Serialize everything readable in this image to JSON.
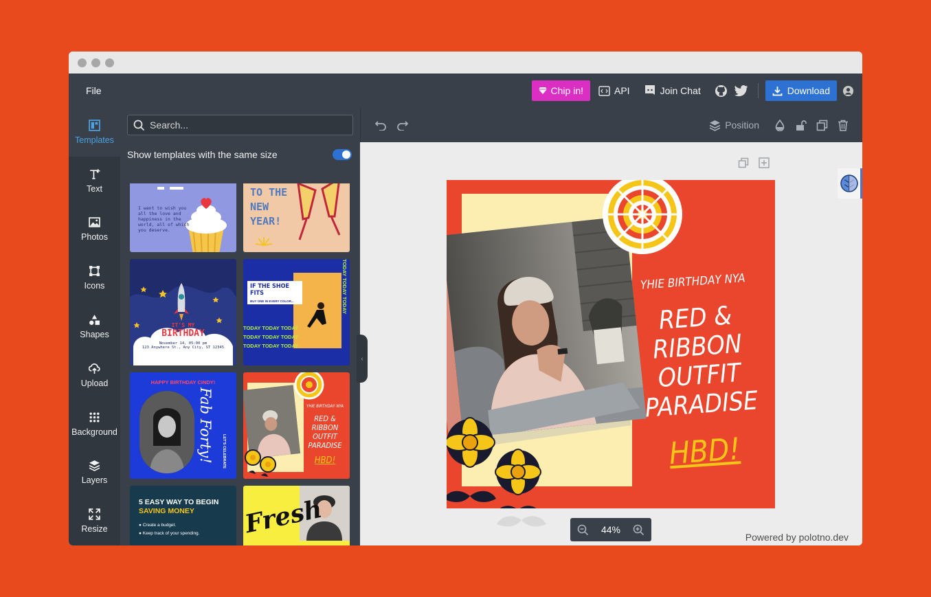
{
  "topbar": {
    "file_label": "File",
    "chip_label": "Chip in!",
    "api_label": "API",
    "chat_label": "Join Chat",
    "download_label": "Download",
    "colors": {
      "chip": "#db2ec3",
      "download": "#2d72d2",
      "bar": "#394049"
    }
  },
  "sidebar": {
    "tabs": [
      {
        "label": "Templates",
        "icon": "templates-icon",
        "active": true
      },
      {
        "label": "Text",
        "icon": "text-icon"
      },
      {
        "label": "Photos",
        "icon": "photos-icon"
      },
      {
        "label": "Icons",
        "icon": "icons-icon"
      },
      {
        "label": "Shapes",
        "icon": "shapes-icon"
      },
      {
        "label": "Upload",
        "icon": "upload-icon"
      },
      {
        "label": "Background",
        "icon": "background-icon"
      },
      {
        "label": "Layers",
        "icon": "layers-icon"
      },
      {
        "label": "Resize",
        "icon": "resize-icon"
      }
    ]
  },
  "panel": {
    "search_placeholder": "Search...",
    "same_size_label": "Show templates with the same size",
    "same_size_on": true,
    "templates": {
      "t1": {
        "lines": [
          "I want to wish you",
          "all the love and",
          "happiness in the",
          "world, all of which",
          "you deserve."
        ]
      },
      "t2": {
        "lines": [
          "TO THE",
          "NEW",
          "YEAR!"
        ]
      },
      "t3": {
        "title_small": "IT'S MY",
        "title_big": "BIRTHDAY",
        "date": "November 14, 05:00 pm",
        "address": "123 Anywhere St., Any City, ST 12345"
      },
      "t4": {
        "headline": "IF THE SHOE FITS",
        "sub": "BUY ONE IN EVERY COLOR...",
        "ticker": "TODAY TODAY TODAY"
      },
      "t5": {
        "top": "HAPPY BIRTHDAY CINDY!",
        "script": "Fab Forty!",
        "side": "LET'S CELEBRATE"
      },
      "t6": {
        "line1": "YHIE BIRTHDAY NYA",
        "line2": "RED & RIBBON",
        "line3": "OUTFIT",
        "line4": "PARADISE",
        "hbd": "HBD!"
      },
      "t7": {
        "title": "5 EASY WAY TO BEGIN",
        "subtitle": "SAVING MONEY",
        "items": [
          "Create a budget.",
          "Keep track of your spending."
        ]
      },
      "t8": {
        "script": "Fresh"
      }
    }
  },
  "toolbar": {
    "position_label": "Position"
  },
  "canvas": {
    "line1": "YHIE BIRTHDAY NYA",
    "line2": "RED & RIBBON",
    "line3": "OUTFIT",
    "line4": "PARADISE",
    "hbd": "HBD!",
    "colors": {
      "background": "#e9462d",
      "paper": "#fbeeb0",
      "accent": "#f5c518"
    }
  },
  "zoom": {
    "value": "44%"
  },
  "footer": {
    "powered_by": "Powered by polotno.dev"
  }
}
